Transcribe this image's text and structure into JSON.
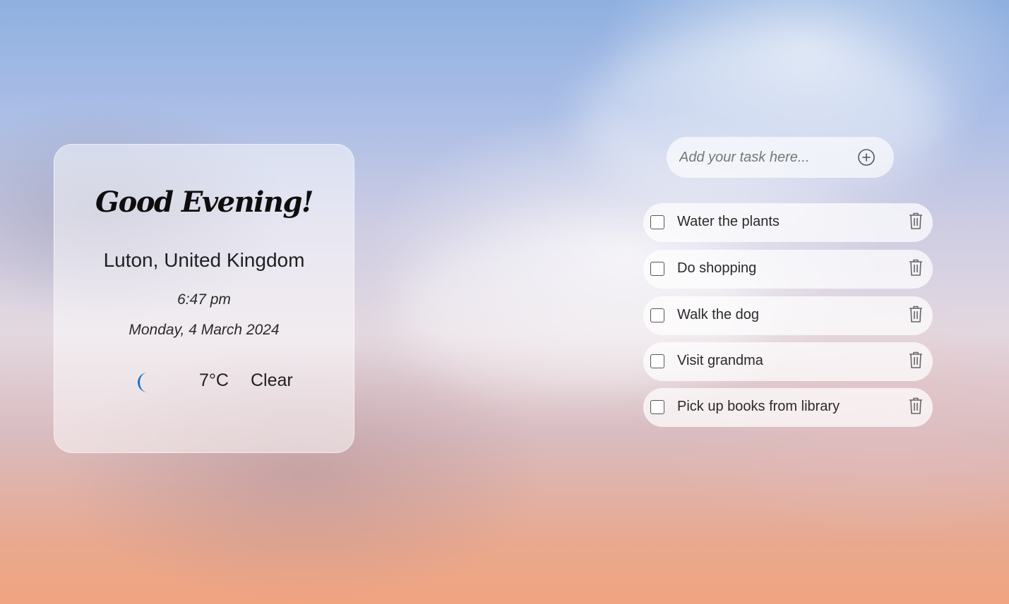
{
  "greeting_card": {
    "greeting": "Good Evening!",
    "location": "Luton, United Kingdom",
    "time": "6:47 pm",
    "date": "Monday, 4 March 2024",
    "weather": {
      "icon": "crescent-moon-icon",
      "temperature": "7°C",
      "condition": "Clear"
    }
  },
  "task_input": {
    "placeholder": "Add your task here...",
    "add_icon": "plus-circle-icon"
  },
  "tasks": [
    {
      "label": "Water the plants",
      "checked": false
    },
    {
      "label": "Do shopping",
      "checked": false
    },
    {
      "label": "Walk the dog",
      "checked": false
    },
    {
      "label": "Visit grandma",
      "checked": false
    },
    {
      "label": "Pick up books from library",
      "checked": false
    }
  ],
  "colors": {
    "moon_icon": "#1a73c8",
    "card_bg": "rgba(255,255,255,0.5)",
    "task_bg": "rgba(255,255,255,0.72)"
  }
}
